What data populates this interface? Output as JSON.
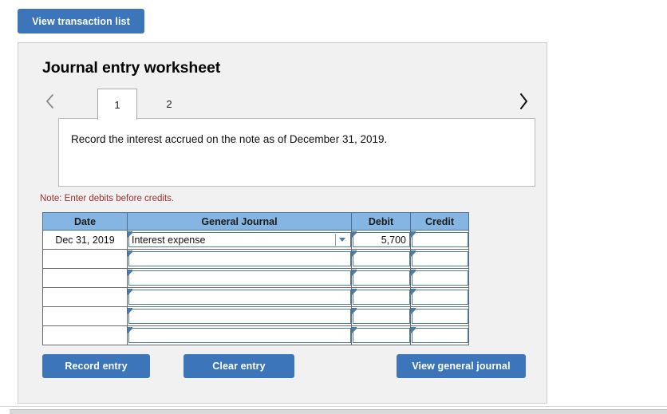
{
  "toolbar": {
    "view_transaction_list_label": "View transaction list"
  },
  "worksheet": {
    "title": "Journal entry worksheet",
    "prev_icon": "chevron-left-icon",
    "next_icon": "chevron-right-icon",
    "tabs": [
      {
        "label": "1",
        "active": true
      },
      {
        "label": "2",
        "active": false
      }
    ],
    "prompt": "Record the interest accrued on the note as of December 31, 2019.",
    "note": "Note: Enter debits before credits."
  },
  "journal": {
    "columns": [
      "Date",
      "General Journal",
      "Debit",
      "Credit"
    ],
    "rows": [
      {
        "date": "Dec 31, 2019",
        "account": "Interest expense",
        "debit": "5,700",
        "credit": "",
        "has_dropdown": true
      },
      {
        "date": "",
        "account": "",
        "debit": "",
        "credit": "",
        "has_dropdown": false
      },
      {
        "date": "",
        "account": "",
        "debit": "",
        "credit": "",
        "has_dropdown": false
      },
      {
        "date": "",
        "account": "",
        "debit": "",
        "credit": "",
        "has_dropdown": false
      },
      {
        "date": "",
        "account": "",
        "debit": "",
        "credit": "",
        "has_dropdown": false
      },
      {
        "date": "",
        "account": "",
        "debit": "",
        "credit": "",
        "has_dropdown": false
      }
    ]
  },
  "actions": {
    "record_entry_label": "Record entry",
    "clear_entry_label": "Clear entry",
    "view_general_journal_label": "View general journal"
  },
  "colors": {
    "button_blue": "#3c75b9",
    "header_blue": "#85b5e2",
    "note_red": "#a03030",
    "panel_gray": "#f1f1f1",
    "field_border_blue": "#4a7aa8"
  }
}
